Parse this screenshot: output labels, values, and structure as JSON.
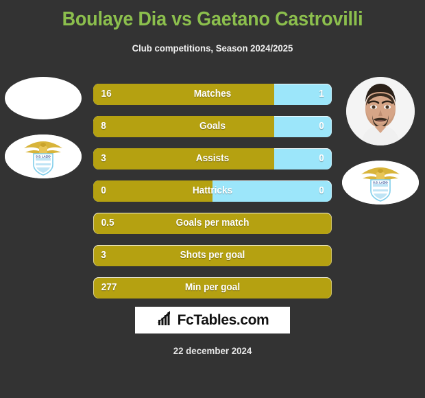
{
  "header": {
    "title": "Boulaye Dia vs Gaetano Castrovilli",
    "subtitle": "Club competitions, Season 2024/2025"
  },
  "colors": {
    "background": "#333333",
    "title_green": "#8cbf4d",
    "bar_gold": "#b5a111",
    "bar_blue": "#9ce6fa",
    "text_white": "#ffffff"
  },
  "left_player": {
    "photo": "player-photo-placeholder",
    "club_logo": "ss-lazio-crest"
  },
  "right_player": {
    "photo": "player-photo-castrovilli",
    "club_logo": "ss-lazio-crest"
  },
  "chart_data": {
    "type": "bar",
    "title": "Boulaye Dia vs Gaetano Castrovilli",
    "subtitle": "Club competitions, Season 2024/2025",
    "series": [
      {
        "name": "Boulaye Dia",
        "color": "#b5a111"
      },
      {
        "name": "Gaetano Castrovilli",
        "color": "#9ce6fa"
      }
    ],
    "categories": [
      "Matches",
      "Goals",
      "Assists",
      "Hattricks",
      "Goals per match",
      "Shots per goal",
      "Min per goal"
    ],
    "rows": [
      {
        "label": "Matches",
        "left": "16",
        "right": "1",
        "left_pct": 76,
        "split": true
      },
      {
        "label": "Goals",
        "left": "8",
        "right": "0",
        "left_pct": 76,
        "split": true
      },
      {
        "label": "Assists",
        "left": "3",
        "right": "0",
        "left_pct": 76,
        "split": true
      },
      {
        "label": "Hattricks",
        "left": "0",
        "right": "0",
        "left_pct": 50,
        "split": true
      },
      {
        "label": "Goals per match",
        "left": "0.5",
        "right": "",
        "left_pct": 100,
        "split": false
      },
      {
        "label": "Shots per goal",
        "left": "3",
        "right": "",
        "left_pct": 100,
        "split": false
      },
      {
        "label": "Min per goal",
        "left": "277",
        "right": "",
        "left_pct": 100,
        "split": false
      }
    ]
  },
  "footer": {
    "brand": "FcTables.com",
    "brand_icon": "bar-chart-icon",
    "date": "22 december 2024"
  }
}
